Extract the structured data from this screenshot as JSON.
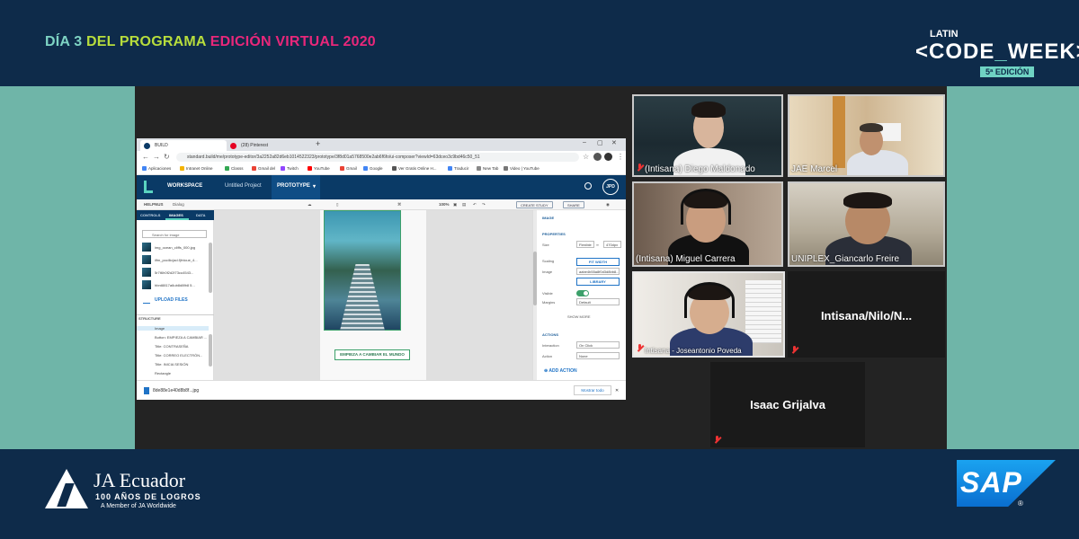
{
  "banner": {
    "part1": "DÍA 3",
    "part2": "DEL PROGRAMA",
    "part3": "EDICIÓN VIRTUAL 2020"
  },
  "event_logo": {
    "latin": "LATIN",
    "code_left": "<CODE",
    "code_underscore": "_",
    "code_right": "WEEK>",
    "edition": "5ª EDICIÓN"
  },
  "sponsor_left": {
    "name": "JA Ecuador",
    "tagline": "100 AÑOS DE LOGROS",
    "member": "A Member of JA Worldwide"
  },
  "sponsor_right": {
    "name": "SAP",
    "reg": "®"
  },
  "browser": {
    "tabs": [
      {
        "label": "BUILD",
        "favicon_color": "#0a3a66"
      },
      {
        "label": "(28) Pinterest",
        "favicon_color": "#e60023"
      }
    ],
    "new_tab": "+",
    "window_controls": [
      "–",
      "▢",
      "✕"
    ],
    "url": "standard.build/me/prototype-editor/3a2252a82d6eb1014522323/prototype/3f8d01a5768500e2ab6f6fo/ui-composer?viewId=63dceo3c9bd46c50_51",
    "bookmarks": [
      {
        "label": "Aplicaciones",
        "color": "#4285f4"
      },
      {
        "label": "Intranet Online",
        "color": "#f4b400"
      },
      {
        "label": "Classs",
        "color": "#34a853"
      },
      {
        "label": "Gmail del",
        "color": "#ea4335"
      },
      {
        "label": "Twitch",
        "color": "#9146ff"
      },
      {
        "label": "YouTube",
        "color": "#ff0000"
      },
      {
        "label": "Gmail",
        "color": "#ea4335"
      },
      {
        "label": "Google",
        "color": "#4285f4"
      },
      {
        "label": "Ver Gratis Online H...",
        "color": "#555555"
      },
      {
        "label": "Traducir",
        "color": "#4285f4"
      },
      {
        "label": "New Tab",
        "color": "#888888"
      },
      {
        "label": "Video | YouTube",
        "color": "#777777"
      }
    ]
  },
  "app": {
    "workspace": "WORKSPACE",
    "project": "Untitled Project",
    "mode": "PROTOTYPE",
    "mode_caret": "▾",
    "user_initials": "JPD",
    "toolbar": {
      "page_label": "HELPNUS",
      "page_sub": "Dialog",
      "zoom": "100%",
      "create_study": "CREATE STUDY",
      "share": "SHARE"
    },
    "left_panel": {
      "tabs": [
        "CONTROLS",
        "IMAGES",
        "DATA"
      ],
      "search_placeholder": "Search for image",
      "images": [
        "img_ocean_cliffs_000.jpg",
        "ilfm_pocilio(ad.f)fnlcue_4...",
        "5r7t6h0f2d2f73cu4543...",
        "hbrd8817a6ub8d8fb8 5..."
      ],
      "upload": "UPLOAD FILES",
      "layers_title": "STRUCTURE",
      "layers": [
        "Image",
        "Button: EMPIEZA A CAMBIAR ...",
        "Title: CONTRASEÑA",
        "Title: CORREO ELECTRÓN...",
        "Title: INICIA SESIÓN",
        "Rectangle"
      ]
    },
    "canvas": {
      "cta": "EMPIEZA A CAMBIAR EL MUNDO"
    },
    "right_panel": {
      "section": "IMAGE",
      "properties": "PROPERTIES",
      "size_label": "Size",
      "size_w": "Flexible",
      "size_h": "470dpx",
      "scaling_label": "Scaling",
      "scaling_value": "FIT WIDTH",
      "image_label": "Image",
      "image_value": "aabe4b55a8f0d3d8bb8...",
      "library": "LIBRARY",
      "visible_label": "Visible",
      "margins_label": "Margins",
      "margins_value": "Default",
      "show_more": "SHOW MORE",
      "actions_head": "ACTIONS",
      "interaction_label": "Interaction",
      "interaction_value": "On Click",
      "action_label": "Action",
      "action_value": "None",
      "add_action": "ADD ACTION"
    },
    "download": {
      "file": "8de88e1e40d8b8f...jpg",
      "show_all": "Mostrar todo"
    }
  },
  "participants": [
    {
      "name": "(Intisana) Diego Maldonado",
      "video": true
    },
    {
      "name": "JAE Marcel",
      "video": true
    },
    {
      "name": "(Intisana) Miguel Carrera",
      "video": true
    },
    {
      "name": "UNIPLEX_Giancarlo Freire",
      "video": true
    },
    {
      "name": "Intisana - Joseantonio Poveda",
      "video": true
    },
    {
      "name": "Intisana/Nilo/N...",
      "video": false
    },
    {
      "name": "Isaac Grijalva",
      "video": false
    }
  ]
}
